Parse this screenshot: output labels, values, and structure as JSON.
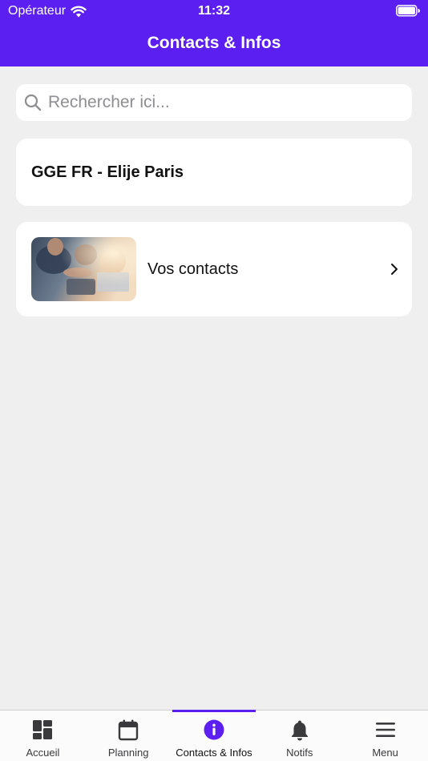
{
  "status_bar": {
    "carrier": "Opérateur",
    "time": "11:32"
  },
  "header": {
    "title": "Contacts & Infos"
  },
  "search": {
    "placeholder": "Rechercher ici..."
  },
  "organization": {
    "name": "GGE FR - Elije Paris"
  },
  "contacts_card": {
    "label": "Vos contacts",
    "image_icon": "team-photo",
    "chevron_icon": "chevron-right-icon"
  },
  "tabs": [
    {
      "label": "Accueil",
      "icon": "dashboard-icon"
    },
    {
      "label": "Planning",
      "icon": "calendar-icon"
    },
    {
      "label": "Contacts & Infos",
      "icon": "info-icon",
      "active": true
    },
    {
      "label": "Notifs",
      "icon": "bell-icon"
    },
    {
      "label": "Menu",
      "icon": "menu-icon"
    }
  ],
  "colors": {
    "accent": "#5b1ff2",
    "background": "#efefef",
    "card": "#ffffff"
  }
}
